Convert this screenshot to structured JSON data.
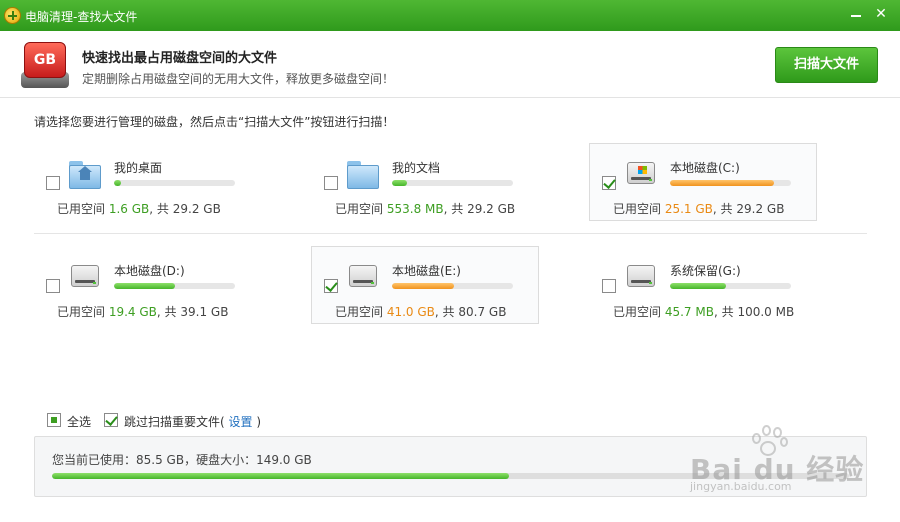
{
  "window": {
    "title": "电脑清理-查找大文件"
  },
  "header": {
    "icon_text": "GB",
    "title": "快速找出最占用磁盘空间的大文件",
    "subtitle": "定期删除占用磁盘空间的无用大文件，释放更多磁盘空间！",
    "scan_button": "扫描大文件"
  },
  "instruction": "请选择您要进行管理的磁盘，然后点击“扫描大文件”按钮进行扫描！",
  "disks": [
    {
      "name": "我的桌面",
      "icon": "folder-home-icon",
      "checked": false,
      "used_label": "已用空间",
      "used": "1.6 GB",
      "sep": ", 共",
      "total": "29.2 GB",
      "fraction": 0.055,
      "level": "normal"
    },
    {
      "name": "我的文档",
      "icon": "folder-icon",
      "checked": false,
      "used_label": "已用空间",
      "used": "553.8 MB",
      "sep": ", 共",
      "total": "29.2 GB",
      "fraction": 0.12,
      "level": "normal"
    },
    {
      "name": "本地磁盘(C:)",
      "icon": "system-drive-icon",
      "checked": true,
      "used_label": "已用空间",
      "used": "25.1 GB",
      "sep": ", 共",
      "total": "29.2 GB",
      "fraction": 0.86,
      "level": "warn"
    },
    {
      "name": "本地磁盘(D:)",
      "icon": "hard-drive-icon",
      "checked": false,
      "used_label": "已用空间",
      "used": "19.4 GB",
      "sep": ", 共",
      "total": "39.1 GB",
      "fraction": 0.5,
      "level": "normal"
    },
    {
      "name": "本地磁盘(E:)",
      "icon": "hard-drive-icon",
      "checked": true,
      "used_label": "已用空间",
      "used": "41.0 GB",
      "sep": ", 共",
      "total": "80.7 GB",
      "fraction": 0.51,
      "level": "warn"
    },
    {
      "name": "系统保留(G:)",
      "icon": "hard-drive-icon",
      "checked": false,
      "used_label": "已用空间",
      "used": "45.7 MB",
      "sep": ", 共",
      "total": "100.0 MB",
      "fraction": 0.46,
      "level": "normal"
    }
  ],
  "options": {
    "select_all": "全选",
    "skip_important": "跳过扫描重要文件(",
    "settings_link": "设置",
    "close_paren": ")"
  },
  "summary": {
    "text": "您当前已使用：85.5 GB，硬盘大小：149.0 GB",
    "fraction": 0.574
  },
  "watermark": {
    "line1": "Bai du 经验",
    "line2": "jingyan.baidu.com"
  },
  "colors": {
    "accent": "#3d9e22",
    "warn": "#e98a15",
    "titlebar": "#2f9a1c"
  }
}
